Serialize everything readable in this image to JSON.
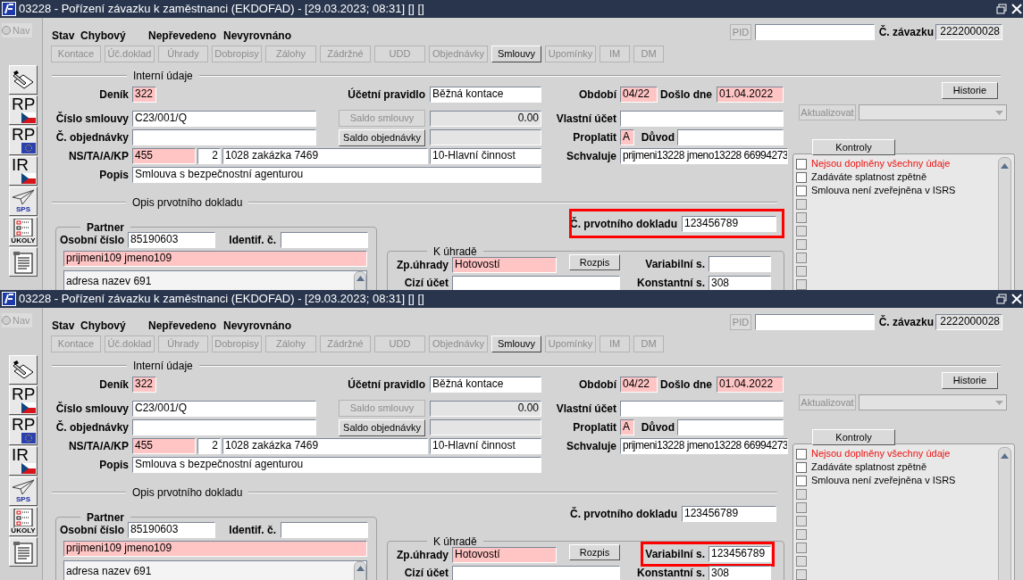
{
  "panels": [
    {
      "title": "03228 - Pořízení závazku k zaměstnanci (EKDOFAD) - [29.03.2023; 08:31] [] []",
      "nav": {
        "label": "Nav",
        "disabled": true
      },
      "status": [
        "Stav",
        "Chybový",
        "Nepřevedeno",
        "Nevyrovnáno"
      ],
      "tabs": [
        {
          "label": "Kontace",
          "disabled": true
        },
        {
          "label": "Úč.doklad",
          "disabled": true
        },
        {
          "label": "Úhrady",
          "disabled": true
        },
        {
          "label": "Dobropisy",
          "disabled": true
        },
        {
          "label": "Zálohy",
          "disabled": true
        },
        {
          "label": "Zádržné",
          "disabled": true
        },
        {
          "label": "UDD",
          "disabled": true
        },
        {
          "label": "Objednávky",
          "disabled": true
        },
        {
          "label": "Smlouvy",
          "disabled": false
        },
        {
          "label": "Upomínky",
          "disabled": true
        },
        {
          "label": "IM",
          "disabled": true
        },
        {
          "label": "DM",
          "disabled": true
        }
      ],
      "sidebar": [
        {
          "kind": "edit"
        },
        {
          "kind": "flag-cz",
          "text": "RP"
        },
        {
          "kind": "flag-eu",
          "text": "RP"
        },
        {
          "kind": "flag-cz",
          "text": "IR"
        },
        {
          "kind": "plane",
          "text": "SPS"
        },
        {
          "kind": "tasks",
          "text": "ÚKOLY"
        },
        {
          "kind": "document"
        }
      ],
      "sections": [
        "Interní údaje",
        "Opis prvotního dokladu"
      ],
      "groups": [
        "Partner",
        "K úhradě"
      ],
      "buttons": [
        {
          "label": "PID",
          "disabled": true
        },
        {
          "label": "Historie",
          "disabled": false
        },
        {
          "label": "Aktualizovat",
          "disabled": true
        },
        {
          "label": "Saldo smlouvy",
          "disabled": true
        },
        {
          "label": "Saldo objednávky",
          "disabled": false
        },
        {
          "label": "Kontroly",
          "disabled": false
        },
        {
          "label": "Rozpis",
          "disabled": false
        }
      ],
      "dropdown": {
        "disabled": true
      },
      "fields": [
        {
          "kind": "normal",
          "highlighted": false
        },
        {
          "label": "Č. závazku",
          "value": "2222000028",
          "kind": "readonly",
          "highlighted": false
        },
        {
          "label": "Deník",
          "value": "322",
          "kind": "required",
          "highlighted": false
        },
        {
          "label": "Účetní pravidlo",
          "value": "Běžná kontace",
          "kind": "normal",
          "highlighted": false
        },
        {
          "label": "Období",
          "value": "04/22",
          "kind": "required",
          "highlighted": false
        },
        {
          "label": "Došlo dne",
          "value": "01.04.2022",
          "kind": "required",
          "highlighted": false
        },
        {
          "label": "Číslo smlouvy",
          "value": "C23/001/Q",
          "kind": "normal",
          "highlighted": false
        },
        {
          "value": "0.00",
          "kind": "readonly",
          "highlighted": false
        },
        {
          "label": "Vlastní účet",
          "kind": "normal",
          "highlighted": false
        },
        {
          "label": "Č. objednávky",
          "kind": "normal",
          "highlighted": false
        },
        {
          "kind": "readonly",
          "highlighted": false
        },
        {
          "label": "Proplatit",
          "value": "A",
          "kind": "required",
          "highlighted": false
        },
        {
          "label": "Důvod",
          "kind": "normal",
          "highlighted": false
        },
        {
          "label": "NS/TA/A/KP",
          "value": "455",
          "kind": "required",
          "highlighted": false
        },
        {
          "value": "2",
          "kind": "normal",
          "highlighted": false
        },
        {
          "value": "1028 zakázka 7469",
          "kind": "normal",
          "highlighted": false
        },
        {
          "value": "10-Hlavní činnost",
          "kind": "normal",
          "highlighted": false
        },
        {
          "label": "Schvaluje",
          "value": "prijmeni13228 jmeno13228 66994273",
          "kind": "normal",
          "highlighted": false
        },
        {
          "label": "Popis",
          "value": "Smlouva s bezpečnostní agenturou",
          "kind": "normal",
          "highlighted": false
        },
        {
          "label": "Č. prvotního dokladu",
          "value": "123456789",
          "kind": "normal",
          "highlighted": true
        },
        {
          "label": "Osobní číslo",
          "value": "85190603",
          "kind": "normal",
          "highlighted": false
        },
        {
          "label": "Identif. č.",
          "kind": "normal",
          "highlighted": false
        },
        {
          "value": "prijmeni109 jmeno109",
          "kind": "required",
          "highlighted": false
        },
        {
          "label": "Zp.úhrady",
          "value": "Hotovostí",
          "kind": "required",
          "highlighted": false
        },
        {
          "label": "Variabilní s.",
          "kind": "normal",
          "highlighted": false
        },
        {
          "label": "Cizí účet",
          "kind": "normal",
          "highlighted": false
        },
        {
          "label": "Konstantní s.",
          "value": "308",
          "kind": "normal",
          "highlighted": false
        }
      ],
      "address": "adresa nazev 691",
      "checks": [
        {
          "kind": "check",
          "text": "Nejsou doplněny všechny údaje",
          "error": true,
          "checked": false
        },
        {
          "kind": "check",
          "text": "Zadáváte splatnost zpětně",
          "error": false,
          "checked": false
        },
        {
          "kind": "check",
          "text": "Smlouva není zveřejněna v ISRS",
          "error": false,
          "checked": false
        },
        {
          "kind": "empty",
          "checked": false
        },
        {
          "kind": "empty",
          "checked": false
        },
        {
          "kind": "empty",
          "checked": false
        },
        {
          "kind": "empty",
          "checked": false
        },
        {
          "kind": "empty",
          "checked": false
        },
        {
          "kind": "empty",
          "checked": false
        },
        {
          "kind": "empty",
          "checked": false
        }
      ]
    },
    {
      "title": "03228 - Pořízení závazku k zaměstnanci (EKDOFAD) - [29.03.2023; 08:31] [] []",
      "nav": {
        "label": "Nav",
        "disabled": true
      },
      "status": [
        "Stav",
        "Chybový",
        "Nepřevedeno",
        "Nevyrovnáno"
      ],
      "tabs": [
        {
          "label": "Kontace",
          "disabled": true
        },
        {
          "label": "Úč.doklad",
          "disabled": true
        },
        {
          "label": "Úhrady",
          "disabled": true
        },
        {
          "label": "Dobropisy",
          "disabled": true
        },
        {
          "label": "Zálohy",
          "disabled": true
        },
        {
          "label": "Zádržné",
          "disabled": true
        },
        {
          "label": "UDD",
          "disabled": true
        },
        {
          "label": "Objednávky",
          "disabled": true
        },
        {
          "label": "Smlouvy",
          "disabled": false
        },
        {
          "label": "Upomínky",
          "disabled": true
        },
        {
          "label": "IM",
          "disabled": true
        },
        {
          "label": "DM",
          "disabled": true
        }
      ],
      "sidebar": [
        {
          "kind": "edit"
        },
        {
          "kind": "flag-cz",
          "text": "RP"
        },
        {
          "kind": "flag-eu",
          "text": "RP"
        },
        {
          "kind": "flag-cz",
          "text": "IR"
        },
        {
          "kind": "plane",
          "text": "SPS"
        },
        {
          "kind": "tasks",
          "text": "ÚKOLY"
        },
        {
          "kind": "document"
        }
      ],
      "sections": [
        "Interní údaje",
        "Opis prvotního dokladu"
      ],
      "groups": [
        "Partner",
        "K úhradě"
      ],
      "buttons": [
        {
          "label": "PID",
          "disabled": true
        },
        {
          "label": "Historie",
          "disabled": false
        },
        {
          "label": "Aktualizovat",
          "disabled": true
        },
        {
          "label": "Saldo smlouvy",
          "disabled": true
        },
        {
          "label": "Saldo objednávky",
          "disabled": false
        },
        {
          "label": "Kontroly",
          "disabled": false
        },
        {
          "label": "Rozpis",
          "disabled": false
        }
      ],
      "dropdown": {
        "disabled": true
      },
      "fields": [
        {
          "kind": "normal",
          "highlighted": false
        },
        {
          "label": "Č. závazku",
          "value": "2222000028",
          "kind": "readonly",
          "highlighted": false
        },
        {
          "label": "Deník",
          "value": "322",
          "kind": "required",
          "highlighted": false
        },
        {
          "label": "Účetní pravidlo",
          "value": "Běžná kontace",
          "kind": "normal",
          "highlighted": false
        },
        {
          "label": "Období",
          "value": "04/22",
          "kind": "required",
          "highlighted": false
        },
        {
          "label": "Došlo dne",
          "value": "01.04.2022",
          "kind": "required",
          "highlighted": false
        },
        {
          "label": "Číslo smlouvy",
          "value": "C23/001/Q",
          "kind": "normal",
          "highlighted": false
        },
        {
          "value": "0.00",
          "kind": "readonly",
          "highlighted": false
        },
        {
          "label": "Vlastní účet",
          "kind": "normal",
          "highlighted": false
        },
        {
          "label": "Č. objednávky",
          "kind": "normal",
          "highlighted": false
        },
        {
          "kind": "readonly",
          "highlighted": false
        },
        {
          "label": "Proplatit",
          "value": "A",
          "kind": "required",
          "highlighted": false
        },
        {
          "label": "Důvod",
          "kind": "normal",
          "highlighted": false
        },
        {
          "label": "NS/TA/A/KP",
          "value": "455",
          "kind": "required",
          "highlighted": false
        },
        {
          "value": "2",
          "kind": "normal",
          "highlighted": false
        },
        {
          "value": "1028 zakázka 7469",
          "kind": "normal",
          "highlighted": false
        },
        {
          "value": "10-Hlavní činnost",
          "kind": "normal",
          "highlighted": false
        },
        {
          "label": "Schvaluje",
          "value": "prijmeni13228 jmeno13228 66994273",
          "kind": "normal",
          "highlighted": false
        },
        {
          "label": "Popis",
          "value": "Smlouva s bezpečnostní agenturou",
          "kind": "normal",
          "highlighted": false
        },
        {
          "label": "Č. prvotního dokladu",
          "value": "123456789",
          "kind": "normal",
          "highlighted": false
        },
        {
          "label": "Osobní číslo",
          "value": "85190603",
          "kind": "normal",
          "highlighted": false
        },
        {
          "label": "Identif. č.",
          "kind": "normal",
          "highlighted": false
        },
        {
          "value": "prijmeni109 jmeno109",
          "kind": "required",
          "highlighted": false
        },
        {
          "label": "Zp.úhrady",
          "value": "Hotovostí",
          "kind": "required",
          "highlighted": false
        },
        {
          "label": "Variabilní s.",
          "value": "123456789",
          "kind": "normal",
          "highlighted": true
        },
        {
          "label": "Cizí účet",
          "kind": "normal",
          "highlighted": false
        },
        {
          "label": "Konstantní s.",
          "value": "308",
          "kind": "normal",
          "highlighted": false
        }
      ],
      "address": "adresa nazev 691",
      "checks": [
        {
          "kind": "check",
          "text": "Nejsou doplněny všechny údaje",
          "error": true,
          "checked": false
        },
        {
          "kind": "check",
          "text": "Zadáváte splatnost zpětně",
          "error": false,
          "checked": false
        },
        {
          "kind": "check",
          "text": "Smlouva není zveřejněna v ISRS",
          "error": false,
          "checked": false
        },
        {
          "kind": "empty",
          "checked": false
        },
        {
          "kind": "empty",
          "checked": false
        },
        {
          "kind": "empty",
          "checked": false
        },
        {
          "kind": "empty",
          "checked": false
        },
        {
          "kind": "empty",
          "checked": false
        },
        {
          "kind": "empty",
          "checked": false
        },
        {
          "kind": "empty",
          "checked": false
        }
      ]
    }
  ]
}
